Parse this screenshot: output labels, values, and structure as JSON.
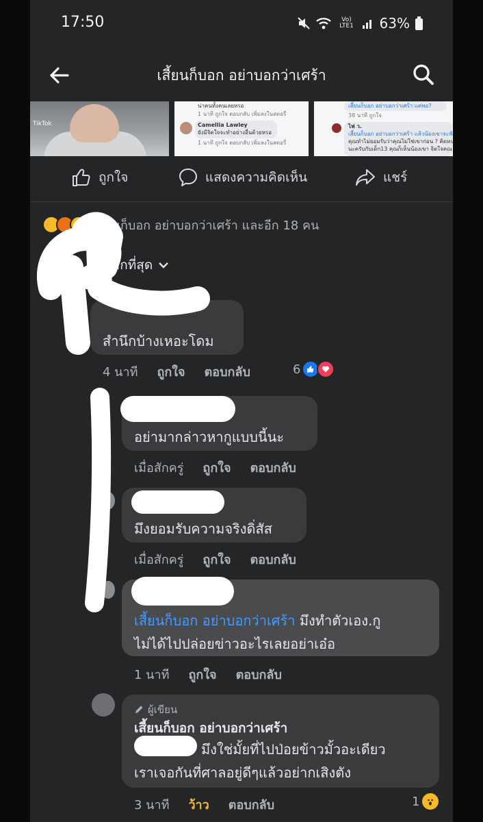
{
  "status_bar": {
    "time": "17:50",
    "network": "Vo) LTE1",
    "battery": "63%"
  },
  "header": {
    "title": "เสี้ยนก็บอก อย่าบอกว่าเศร้า"
  },
  "media": {
    "thumb1_badge": "TikTok",
    "thumb2_lines": [
      "น่าคนทั้งคนเลยหรอ",
      "1 นาที   ถูกใจ   ตอบกลับ   เพิ่มลงในสตอรี่",
      "Camellia Lawley",
      "ยังมีจิตใจจะทำอย่างอื่นด้วยหรอ",
      "1 นาที   ถูกใจ   ตอบกลับ   เพิ่มลงในสตอรี่"
    ],
    "thumb3_lines": [
      "เสี้ยนก็บอก อย่าบอกว่าเศร้า แค่พอ?",
      "38 นาที   ถูกใจ",
      "ไฟ ว.",
      "เสี้ยนก็บอก อย่าบอกว่าเศร้า แล้วน้องเขาจะฟัน",
      "คุณทำไม่ยอมรับว่าคุณไม่ใช่เขาก่อน ? คิดหน่อย",
      "นะครับกับเด็ก13 คุณก็เห็นน้องเขา จิตใจคณ"
    ]
  },
  "actions": {
    "like": "ถูกใจ",
    "comment": "แสดงความคิดเห็น",
    "share": "แชร์"
  },
  "reactions": {
    "text": "เสี้ยนก็บอก อย่าบอกว่าเศร้า และอีก 18 คน"
  },
  "sort": {
    "label": "มากที่สุด"
  },
  "comments": [
    {
      "text": "สำนึกบ้างเหอะโดม",
      "time": "4 นาที",
      "like": "ถูกใจ",
      "reply": "ตอบกลับ",
      "reaction_count": "6"
    },
    {
      "text": "อย่ามากล่าวหากูแบบนี้นะ",
      "time": "เมื่อสักครู่",
      "like": "ถูกใจ",
      "reply": "ตอบกลับ"
    },
    {
      "text": "มึงยอมรับความจริงดิ่สัส",
      "time": "เมื่อสักครู่",
      "like": "ถูกใจ",
      "reply": "ตอบกลับ"
    },
    {
      "mention": "เสี้ยนก็บอก อย่าบอกว่าเศร้า",
      "text_line1": "มึงทำตัวเอง.กู",
      "text_line2": "ไม่ได้ไปปล่อยข่าวอะไรเลยอย่าเอ๋อ",
      "time": "1 นาที",
      "like": "ถูกใจ",
      "reply": "ตอบกลับ"
    },
    {
      "author_badge": "ผู้เขียน",
      "author": "เสี้ยนก็บอก อย่าบอกว่าเศร้า",
      "text_line1": "มึงใช่มั้ยที่ไปป่อยข้าวมั้วอะเดียว",
      "text_line2": "เราเจอกันที่ศาลอยู่ดีๆแล้วอย่ากเสิงตัง",
      "time": "3 นาที",
      "like": "ว้าว",
      "reply": "ตอบกลับ",
      "reaction_count": "1"
    }
  ],
  "colors": {
    "background": "#242526",
    "bubble": "#3a3b3c",
    "link": "#4599ff",
    "wow_label": "#f7b928"
  }
}
